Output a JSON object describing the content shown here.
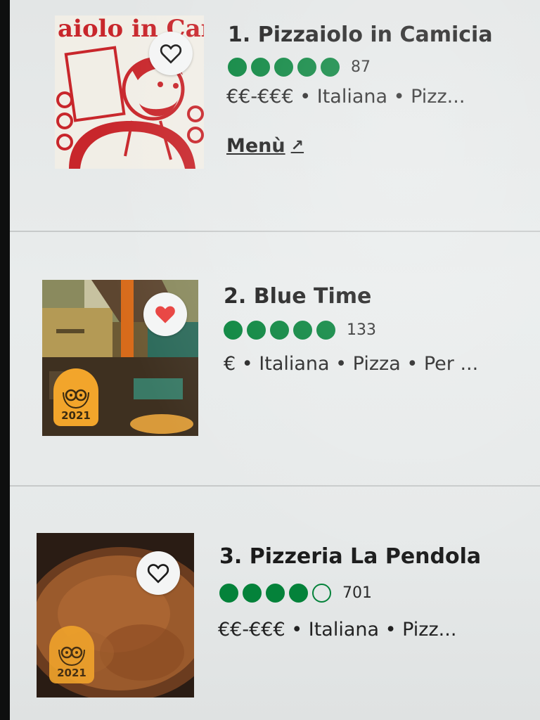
{
  "listings": [
    {
      "title": "1. Pizzaiolo in Camicia",
      "bubbles_filled": 5,
      "bubbles_total": 5,
      "review_count": "87",
      "meta": "€€-€€€ • Italiana • Pizz...",
      "menu_label": "Menù",
      "menu_icon": "external-arrow-icon",
      "saved": false,
      "logo_text": "aiolo in Cam",
      "award_year": null
    },
    {
      "title": "2. Blue Time",
      "bubbles_filled": 5,
      "bubbles_total": 5,
      "review_count": "133",
      "meta": "€ • Italiana • Pizza • Per ...",
      "saved": true,
      "award_year": "2021"
    },
    {
      "title": "3. Pizzeria La Pendola",
      "bubbles_filled": 4,
      "bubbles_total": 5,
      "review_count": "701",
      "meta": "€€-€€€ • Italiana • Pizz...",
      "saved": false,
      "award_year": "2021"
    }
  ],
  "colors": {
    "rating_green": "#04823a",
    "heart_saved": "#e8423f",
    "award_badge": "#f2a52b",
    "logo_red": "#c8262b"
  }
}
